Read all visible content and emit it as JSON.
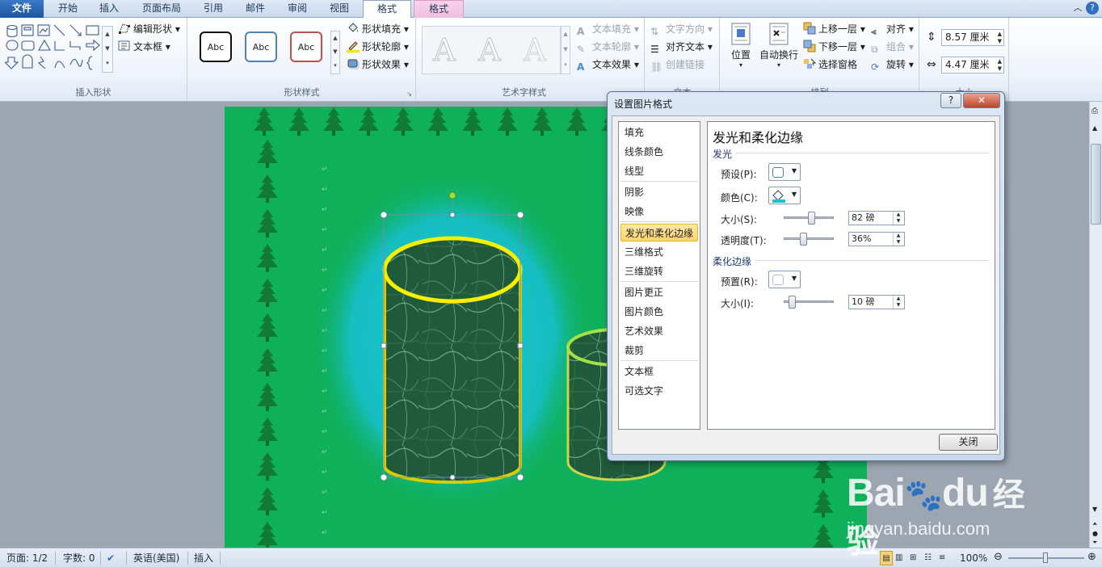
{
  "tabs": {
    "file": "文件",
    "home": "开始",
    "insert": "插入",
    "layout": "页面布局",
    "references": "引用",
    "mailings": "邮件",
    "review": "审阅",
    "view": "视图",
    "format": "格式",
    "format2": "格式"
  },
  "ribbon": {
    "insert_shapes": {
      "edit_shape": "编辑形状",
      "textbox": "文本框",
      "label": "插入形状"
    },
    "shape_styles": {
      "abc": "Abc",
      "fill": "形状填充",
      "outline": "形状轮廓",
      "effect": "形状效果",
      "label": "形状样式"
    },
    "wordart": {
      "letter": "A",
      "text_fill": "文本填充",
      "text_outline": "文本轮廓",
      "text_effect": "文本效果",
      "label": "艺术字样式"
    },
    "text": {
      "direction": "文字方向",
      "align": "对齐文本",
      "link": "创建链接",
      "label": "文本"
    },
    "arrange": {
      "position": "位置",
      "wrap": "自动换行",
      "bring_forward": "上移一层",
      "send_backward": "下移一层",
      "selection_pane": "选择窗格",
      "align": "对齐",
      "group": "组合",
      "rotate": "旋转",
      "label": "排列"
    },
    "size": {
      "height": "8.57 厘米",
      "width": "4.47 厘米",
      "label": "大小"
    }
  },
  "dialog": {
    "title": "设置图片格式",
    "help": "?",
    "close_x": "✕",
    "categories": [
      "填充",
      "线条颜色",
      "线型",
      "阴影",
      "映像",
      "发光和柔化边缘",
      "三维格式",
      "三维旋转",
      "图片更正",
      "图片颜色",
      "艺术效果",
      "裁剪",
      "文本框",
      "可选文字"
    ],
    "selected_category": "发光和柔化边缘",
    "panel_title": "发光和柔化边缘",
    "glow": {
      "heading": "发光",
      "preset_label": "预设(P):",
      "color_label": "颜色(C):",
      "size_label": "大小(S):",
      "size_value": "82 磅",
      "size_fraction": 0.55,
      "transparency_label": "透明度(T):",
      "transparency_value": "36%",
      "transparency_fraction": 0.36
    },
    "soft_edges": {
      "heading": "柔化边缘",
      "preset_label": "预置(R):",
      "size_label": "大小(I):",
      "size_value": "10 磅",
      "size_fraction": 0.1
    },
    "close_button": "关闭"
  },
  "status": {
    "page": "页面: 1/2",
    "words": "字数: 0",
    "language": "英语(美国)",
    "mode": "插入",
    "zoom": "100%"
  },
  "watermark": {
    "brand": "Bai",
    "brand2": "du",
    "cn": "经验",
    "url": "jingyan.baidu.com"
  },
  "colors": {
    "page_green": "#0fb05a",
    "glow_cyan": "#18c4c8",
    "cylinder_outline": "#f2e600",
    "tab_blue": "#1e56a0"
  }
}
